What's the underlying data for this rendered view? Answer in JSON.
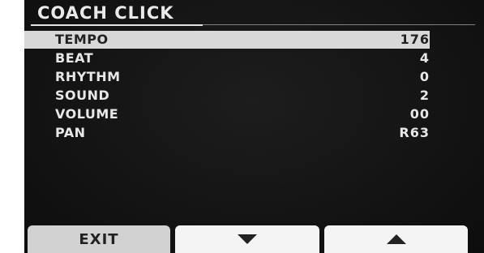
{
  "header": {
    "title": "COACH CLICK"
  },
  "params": [
    {
      "name": "TEMPO",
      "value": "176",
      "selected": true
    },
    {
      "name": "BEAT",
      "value": "4",
      "selected": false
    },
    {
      "name": "RHYTHM",
      "value": "0",
      "selected": false
    },
    {
      "name": "SOUND",
      "value": "2",
      "selected": false
    },
    {
      "name": "VOLUME",
      "value": "00",
      "selected": false
    },
    {
      "name": "PAN",
      "value": "R63",
      "selected": false
    }
  ],
  "buttons": {
    "exit_label": "EXIT",
    "down_icon": "triangle-down-icon",
    "up_icon": "triangle-up-icon"
  },
  "colors": {
    "screen_bg": "#111111",
    "highlight": "#d8d8d8",
    "text": "#e7e7e7"
  }
}
